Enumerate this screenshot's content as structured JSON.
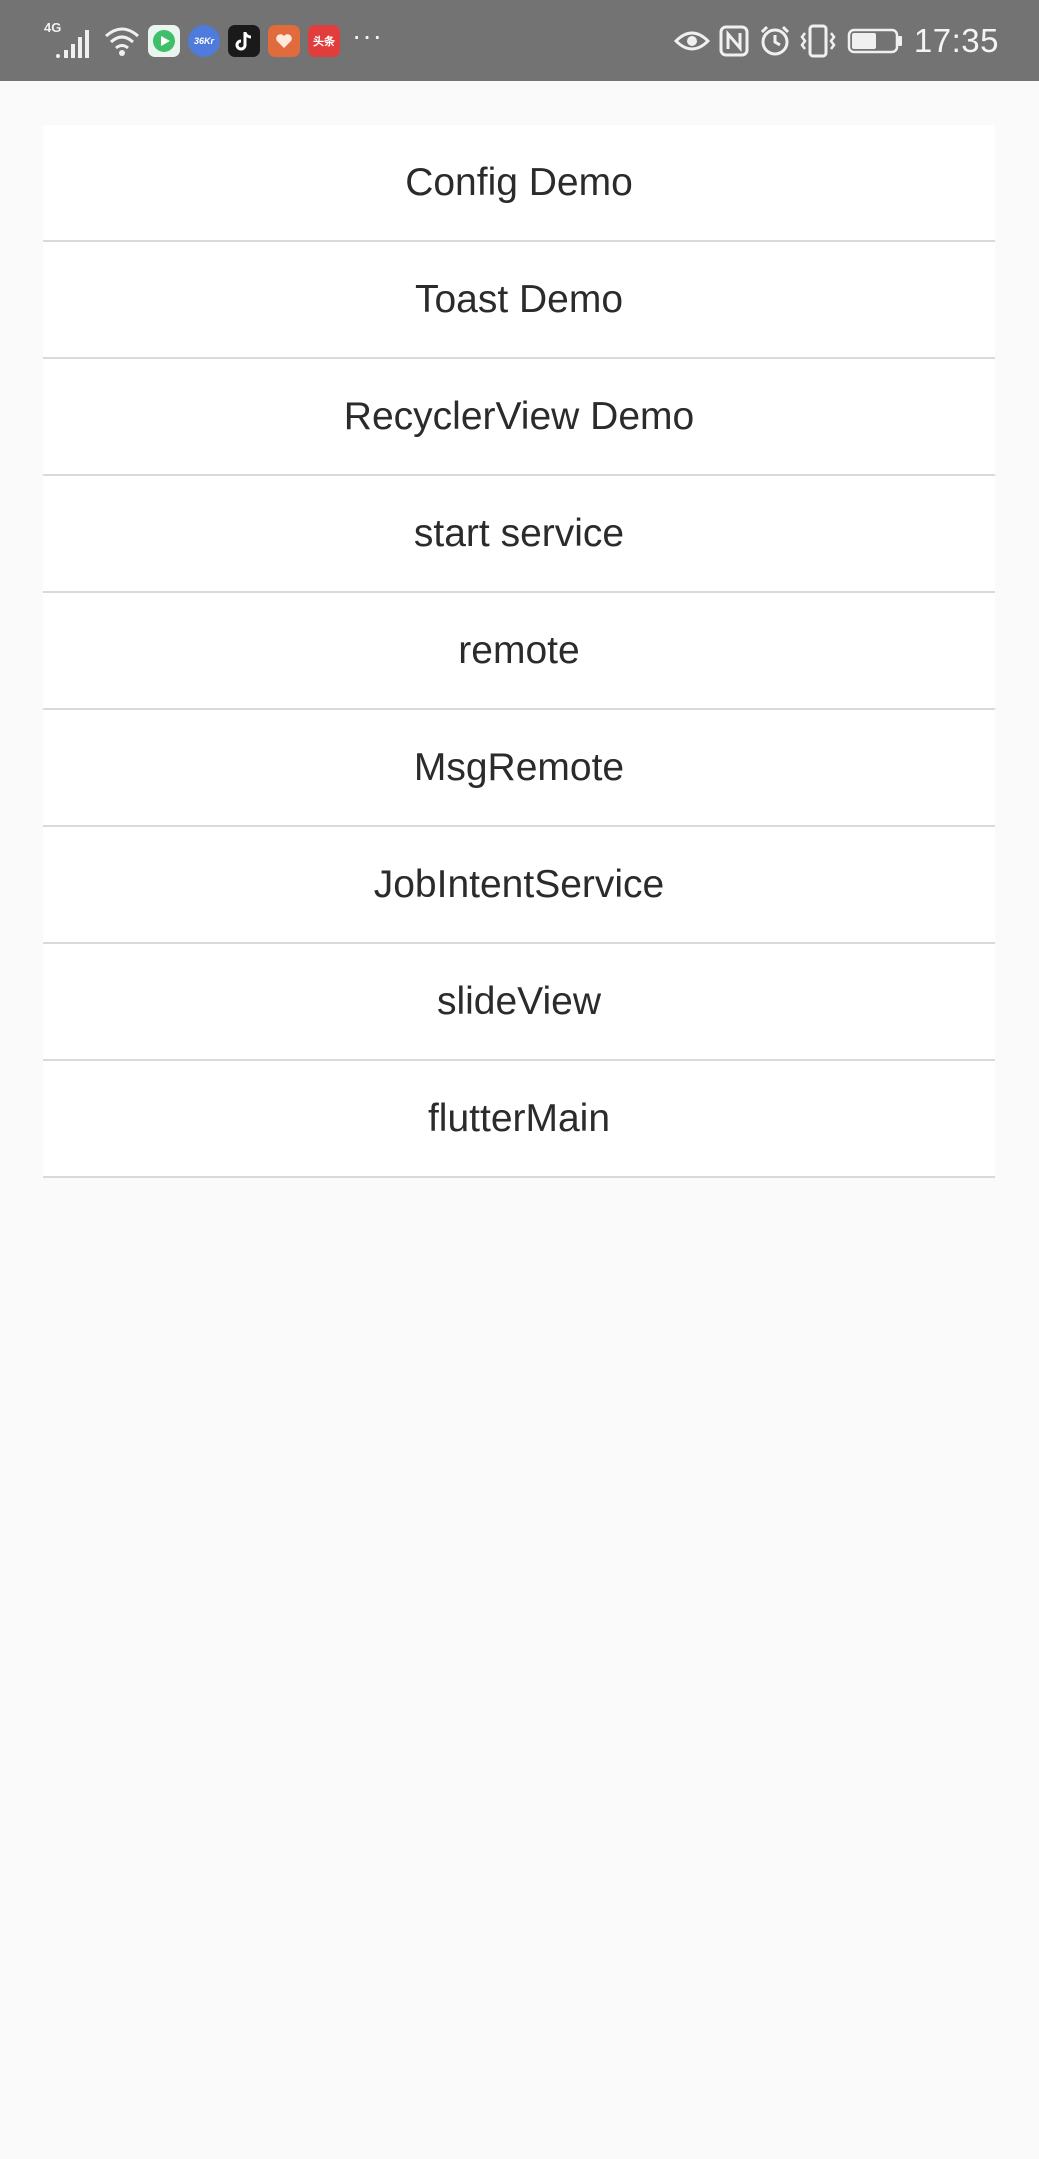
{
  "status_bar": {
    "network_type": "4G",
    "time": "17:35",
    "left_icons": [
      "signal-icon",
      "wifi-icon",
      "video-app-icon",
      "36kr-app-icon",
      "tiktok-app-icon",
      "heart-app-icon",
      "toutiao-app-icon",
      "more-notifications-icon"
    ],
    "right_icons": [
      "eye-comfort-icon",
      "nfc-icon",
      "alarm-icon",
      "vibrate-icon",
      "battery-icon"
    ],
    "apps": {
      "video_app_color": "#3fbf6a",
      "kr_label": "36Kr",
      "kr_color": "#4f7bdc",
      "tiktok_color": "#1a1a1a",
      "heart_color": "#e06b3c",
      "toutiao_label": "头条",
      "toutiao_color": "#e23d3d"
    },
    "background_color": "#737373"
  },
  "menu": {
    "items": [
      {
        "label": "Config Demo"
      },
      {
        "label": "Toast Demo"
      },
      {
        "label": "RecyclerView Demo"
      },
      {
        "label": "start service"
      },
      {
        "label": "remote"
      },
      {
        "label": "MsgRemote"
      },
      {
        "label": "JobIntentService"
      },
      {
        "label": "slideView"
      },
      {
        "label": "flutterMain"
      }
    ]
  },
  "colors": {
    "page_background": "#fafafa",
    "list_background": "#ffffff",
    "divider": "#d9d9d9",
    "text": "#2b2b2b"
  }
}
